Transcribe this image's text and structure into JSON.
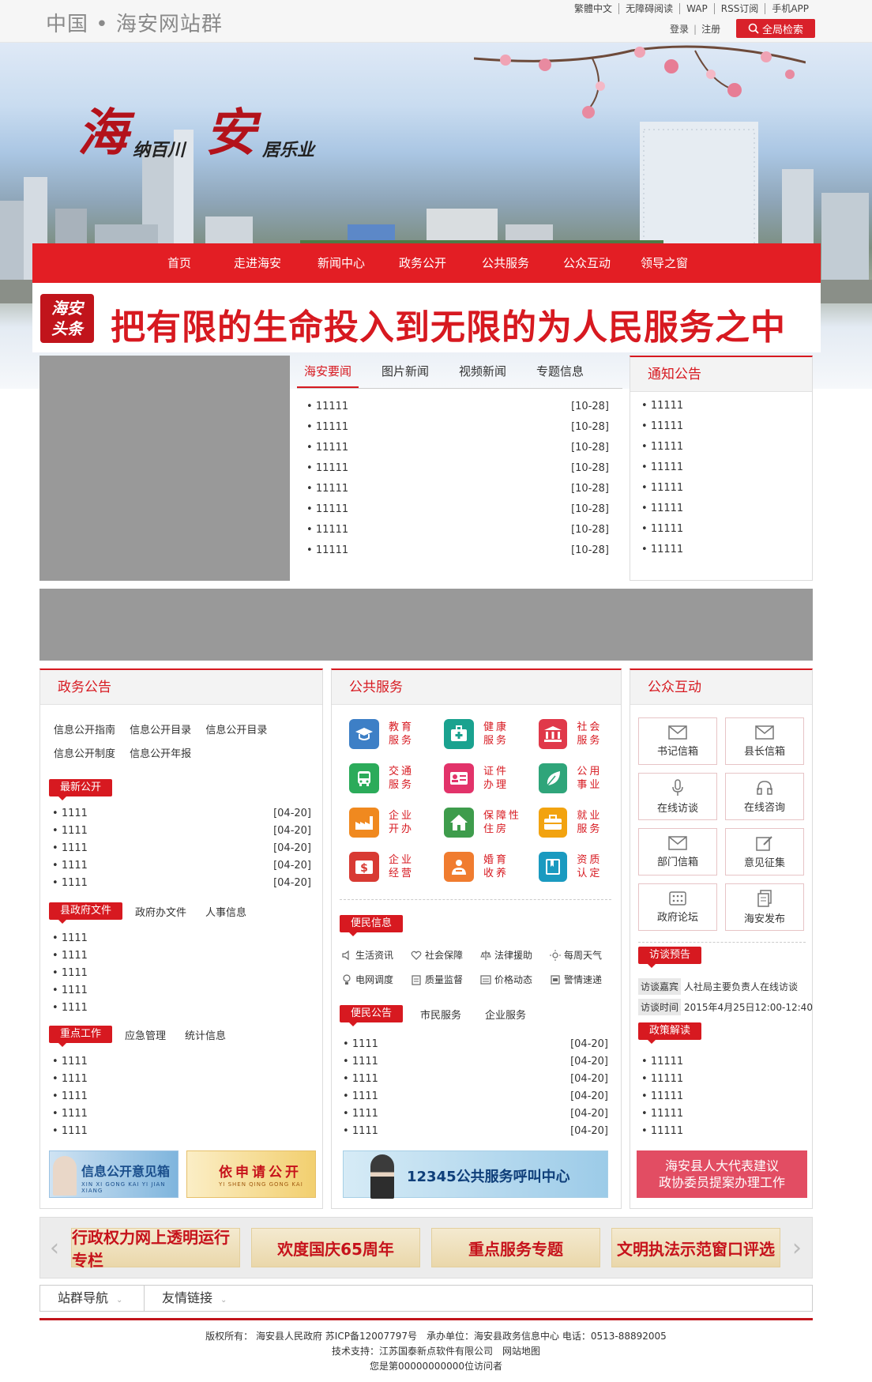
{
  "header": {
    "site_name": "中国 • 海安网站群",
    "links": [
      "繁體中文",
      "无障碍阅读",
      "WAP",
      "RSS订阅",
      "手机APP"
    ],
    "login": "登录",
    "register": "注册",
    "search_button": "全局检索"
  },
  "banner": {
    "hai": "海",
    "na_bai_chuan": "纳百川",
    "an": "安",
    "ju_le_ye": "居乐业"
  },
  "nav": [
    "首页",
    "走进海安",
    "新闻中心",
    "政务公开",
    "公共服务",
    "公众互动",
    "领导之窗"
  ],
  "headline": {
    "badge_line1": "海安",
    "badge_line2": "头条",
    "text": "把有限的生命投入到无限的为人民服务之中"
  },
  "news": {
    "tabs": [
      "海安要闻",
      "图片新闻",
      "视频新闻",
      "专题信息"
    ],
    "items": [
      {
        "title": "11111",
        "date": "[10-28]"
      },
      {
        "title": "11111",
        "date": "[10-28]"
      },
      {
        "title": "11111",
        "date": "[10-28]"
      },
      {
        "title": "11111",
        "date": "[10-28]"
      },
      {
        "title": "11111",
        "date": "[10-28]"
      },
      {
        "title": "11111",
        "date": "[10-28]"
      },
      {
        "title": "11111",
        "date": "[10-28]"
      },
      {
        "title": "11111",
        "date": "[10-28]"
      }
    ]
  },
  "notice": {
    "title": "通知公告",
    "items": [
      "11111",
      "11111",
      "11111",
      "11111",
      "11111",
      "11111",
      "11111",
      "11111"
    ]
  },
  "gov": {
    "title": "政务公告",
    "links": [
      "信息公开指南",
      "信息公开目录",
      "信息公开目录",
      "信息公开制度",
      "信息公开年报"
    ],
    "latest_tag": "最新公开",
    "latest": [
      {
        "title": "1111",
        "date": "[04-20]"
      },
      {
        "title": "1111",
        "date": "[04-20]"
      },
      {
        "title": "1111",
        "date": "[04-20]"
      },
      {
        "title": "1111",
        "date": "[04-20]"
      },
      {
        "title": "1111",
        "date": "[04-20]"
      }
    ],
    "files_tab": "县政府文件",
    "files_tab2": "政府办文件",
    "files_tab3": "人事信息",
    "files": [
      "1111",
      "1111",
      "1111",
      "1111",
      "1111"
    ],
    "key_tab": "重点工作",
    "key_tab2": "应急管理",
    "key_tab3": "统计信息",
    "key": [
      "1111",
      "1111",
      "1111",
      "1111",
      "1111"
    ],
    "banner1": "信息公开意见箱",
    "banner1_sub": "XIN XI GONG KAI YI JIAN XIANG",
    "banner2": "依申请公开",
    "banner2_sub": "YI SHEN QING GONG KAI"
  },
  "service": {
    "title": "公共服务",
    "items": [
      {
        "l1": "教育",
        "l2": "服务",
        "color": "#3d7fc6",
        "icon": "mortarboard-icon"
      },
      {
        "l1": "健康",
        "l2": "服务",
        "color": "#1aa28f",
        "icon": "medkit-icon"
      },
      {
        "l1": "社会",
        "l2": "服务",
        "color": "#e0394a",
        "icon": "institution-icon"
      },
      {
        "l1": "交通",
        "l2": "服务",
        "color": "#2bab5a",
        "icon": "bus-icon"
      },
      {
        "l1": "证件",
        "l2": "办理",
        "color": "#e2336a",
        "icon": "idcard-icon"
      },
      {
        "l1": "公用",
        "l2": "事业",
        "color": "#2fa57a",
        "icon": "leaf-icon"
      },
      {
        "l1": "企业",
        "l2": "开办",
        "color": "#f0891f",
        "icon": "factory-icon"
      },
      {
        "l1": "保障性",
        "l2": "住房",
        "color": "#3e9c4c",
        "icon": "house-icon"
      },
      {
        "l1": "就业",
        "l2": "服务",
        "color": "#f2a310",
        "icon": "briefcase-icon"
      },
      {
        "l1": "企业",
        "l2": "经营",
        "color": "#d83a33",
        "icon": "money-icon"
      },
      {
        "l1": "婚育",
        "l2": "收养",
        "color": "#f07c2f",
        "icon": "family-icon"
      },
      {
        "l1": "资质",
        "l2": "认定",
        "color": "#1a9ac0",
        "icon": "book-icon"
      }
    ],
    "bianmin_tag": "便民信息",
    "bianmin": [
      {
        "label": "生活资讯",
        "icon": "speaker-icon"
      },
      {
        "label": "社会保障",
        "icon": "heart-icon"
      },
      {
        "label": "法律援助",
        "icon": "scales-icon"
      },
      {
        "label": "每周天气",
        "icon": "sun-icon"
      },
      {
        "label": "电网调度",
        "icon": "bulb-icon"
      },
      {
        "label": "质量监督",
        "icon": "clipboard-icon"
      },
      {
        "label": "价格动态",
        "icon": "chart-icon"
      },
      {
        "label": "警情速递",
        "icon": "alarm-icon"
      }
    ],
    "notice_tag": "便民公告",
    "notice_tab2": "市民服务",
    "notice_tab3": "企业服务",
    "notices": [
      {
        "title": "1111",
        "date": "[04-20]"
      },
      {
        "title": "1111",
        "date": "[04-20]"
      },
      {
        "title": "1111",
        "date": "[04-20]"
      },
      {
        "title": "1111",
        "date": "[04-20]"
      },
      {
        "title": "1111",
        "date": "[04-20]"
      },
      {
        "title": "1111",
        "date": "[04-20]"
      }
    ],
    "hotline": "12345公共服务呼叫中心"
  },
  "interact": {
    "title": "公众互动",
    "buttons": [
      {
        "label": "书记信箱",
        "icon": "mail-icon"
      },
      {
        "label": "县长信箱",
        "icon": "mail-icon"
      },
      {
        "label": "在线访谈",
        "icon": "microphone-icon"
      },
      {
        "label": "在线咨询",
        "icon": "headset-icon"
      },
      {
        "label": "部门信箱",
        "icon": "mail-icon"
      },
      {
        "label": "意见征集",
        "icon": "edit-icon"
      },
      {
        "label": "政府论坛",
        "icon": "grid-icon"
      },
      {
        "label": "海安发布",
        "icon": "document-icon"
      }
    ],
    "preview_tag": "访谈预告",
    "guest_label": "访谈嘉宾",
    "guest_value": "人社局主要负责人在线访谈",
    "time_label": "访谈时间",
    "time_value": "2015年4月25日12:00-12:40",
    "policy_tag": "政策解读",
    "policy": [
      "11111",
      "11111",
      "11111",
      "11111",
      "11111"
    ],
    "promo_line1": "海安县人大代表建议",
    "promo_line2": "政协委员提案办理工作"
  },
  "strips": [
    "行政权力网上透明运行专栏",
    "欢度国庆65周年",
    "重点服务专题",
    "文明执法示范窗口评选"
  ],
  "bottom_nav": [
    "站群导航",
    "友情链接"
  ],
  "footer": {
    "line1": "版权所有： 海安县人民政府 苏ICP备12007797号　承办单位：海安县政务信息中心 电话：0513-88892005",
    "line2": "技术支持：江苏国泰新点软件有限公司　网站地图",
    "line3": "您是第00000000000位访问者"
  }
}
